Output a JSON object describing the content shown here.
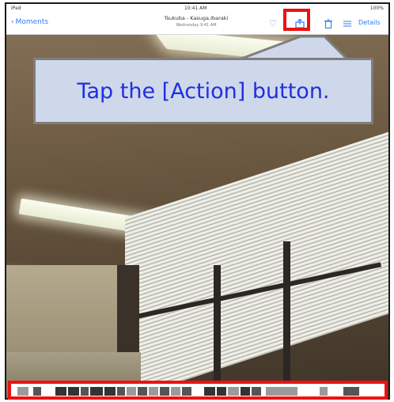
{
  "status_bar": {
    "carrier": "iPad",
    "time": "10:41 AM",
    "battery": "100%"
  },
  "nav_bar": {
    "back_label": "Moments",
    "title": "Tsukuba - Kasuga,Ibaraki",
    "subtitle": "Wednesday 9:41 AM",
    "details_label": "Details",
    "icons": [
      "heart-icon",
      "action-icon",
      "trash-icon",
      "edit-icon"
    ]
  },
  "callout": {
    "instruction": "Tap the [Action] button."
  },
  "colors": {
    "highlight": "#ee1111",
    "callout_text": "#1f2fe0",
    "callout_bg": "#cfd8ea",
    "ios_blue": "#2d7cf6"
  }
}
